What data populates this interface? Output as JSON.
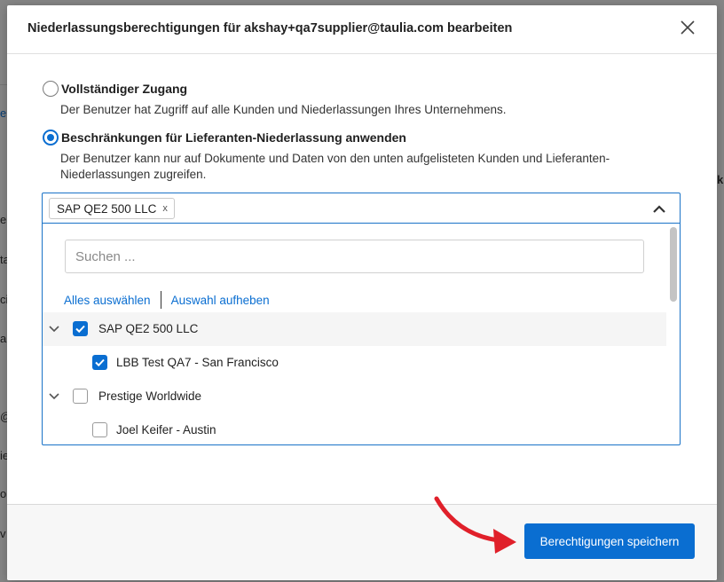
{
  "modal": {
    "title": "Niederlassungsberechtigungen für akshay+qa7supplier@taulia.com bearbeiten",
    "close_icon": "close-icon"
  },
  "access": {
    "full": {
      "label": "Vollständiger Zugang",
      "description": "Der Benutzer hat Zugriff auf alle Kunden und Niederlassungen Ihres Unternehmens.",
      "checked": false
    },
    "restricted": {
      "label": "Beschränkungen für Lieferanten-Niederlassung anwenden",
      "description": "Der Benutzer kann nur auf Dokumente und Daten von den unten aufgelisteten Kunden und Lieferanten-Niederlassungen zugreifen.",
      "checked": true
    }
  },
  "multiselect": {
    "token": "SAP QE2 500 LLC",
    "token_remove": "x",
    "search_placeholder": "Suchen ...",
    "select_all": "Alles auswählen",
    "clear_selection": "Auswahl aufheben",
    "tree": [
      {
        "label": "SAP QE2 500 LLC",
        "checked": true,
        "level": 0
      },
      {
        "label": "LBB Test QA7 - San Francisco",
        "checked": true,
        "level": 1
      },
      {
        "label": "Prestige Worldwide",
        "checked": false,
        "level": 0
      },
      {
        "label": "Joel Keifer - Austin",
        "checked": false,
        "level": 1
      }
    ]
  },
  "footer": {
    "save_label": "Berechtigungen speichern"
  },
  "colors": {
    "accent": "#0a6ed1",
    "arrow": "#e0202a"
  }
}
